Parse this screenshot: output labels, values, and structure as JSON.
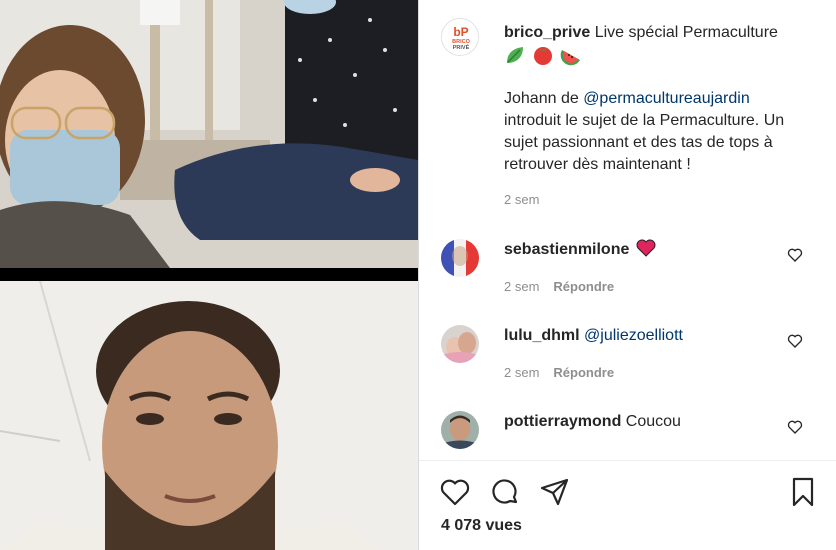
{
  "post": {
    "author": "brico_prive",
    "title_text": "Live spécial Permaculture",
    "emoji_icons": [
      "leaf-icon",
      "tomato-icon",
      "watermelon-icon"
    ],
    "body_prefix": "Johann de ",
    "body_mention": "@permacultureaujardin",
    "body_rest": " introduit le sujet de la Permaculture. Un sujet passionnant et des tas de tops à retrouver dès maintenant !",
    "time": "2 sem",
    "brand_logo_text": [
      "bP",
      "BRICO",
      "PRIVÉ"
    ]
  },
  "comments": [
    {
      "username": "sebastienmilone",
      "text": "",
      "emoji": "red-heart-icon",
      "time": "2 sem",
      "reply_label": "Répondre",
      "avatar_icon": "french-flag-avatar"
    },
    {
      "username": "lulu_dhml",
      "text": "@juliezoelliott",
      "time": "2 sem",
      "reply_label": "Répondre",
      "avatar_icon": "child-photo-avatar"
    },
    {
      "username": "pottierraymond",
      "text": "Coucou",
      "avatar_icon": "man-photo-avatar"
    }
  ],
  "actions": {
    "icons": [
      "heart-outline-icon",
      "comment-bubble-icon",
      "share-paper-plane-icon",
      "bookmark-icon"
    ],
    "views": "4 078 vues"
  },
  "colors": {
    "text": "#262626",
    "muted": "#8e8e8e",
    "link": "#00376b",
    "heart": "#ed4956"
  }
}
